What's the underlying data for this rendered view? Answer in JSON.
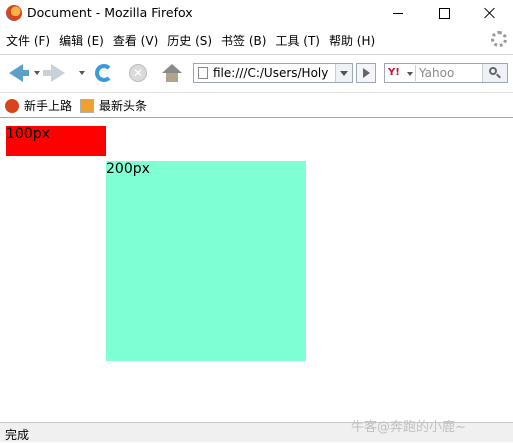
{
  "window": {
    "title": "Document - Mozilla Firefox"
  },
  "menu": {
    "items": [
      "文件 (F)",
      "编辑 (E)",
      "查看 (V)",
      "历史 (S)",
      "书签 (B)",
      "工具 (T)",
      "帮助 (H)"
    ]
  },
  "navbar": {
    "url": "file:///C:/Users/Holy",
    "search_engine": "Y!",
    "search_placeholder": "Yahoo"
  },
  "bookmarks": {
    "items": [
      "新手上路",
      "最新头条"
    ]
  },
  "content": {
    "small_box_label": "100px",
    "big_box_label": "200px",
    "small_box_color": "#ff0000",
    "big_box_color": "#7fffd4"
  },
  "status": {
    "text": "完成"
  },
  "watermark": "牛客@奔跑的小鹿~"
}
